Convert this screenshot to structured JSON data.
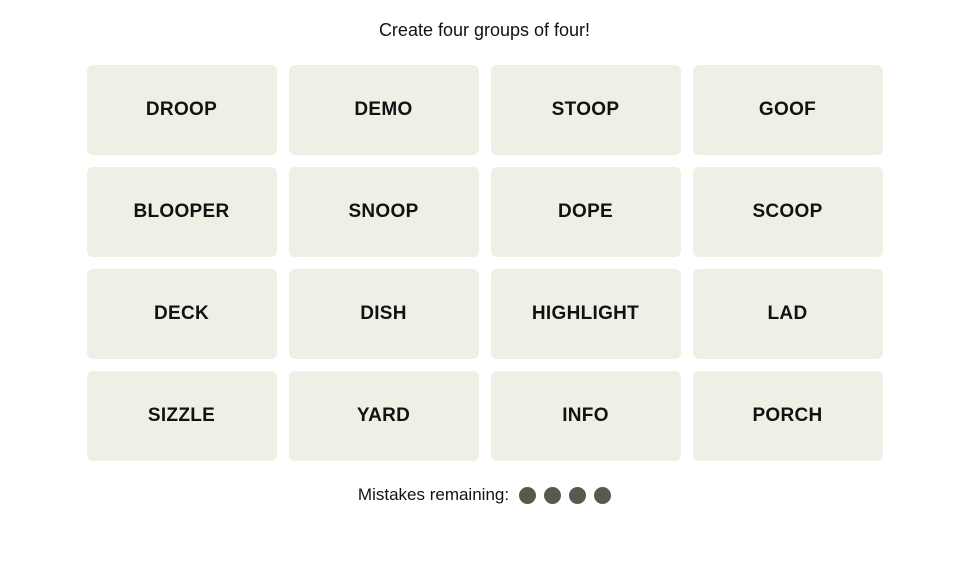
{
  "instruction": "Create four groups of four!",
  "tiles": [
    "DROOP",
    "DEMO",
    "STOOP",
    "GOOF",
    "BLOOPER",
    "SNOOP",
    "DOPE",
    "SCOOP",
    "DECK",
    "DISH",
    "HIGHLIGHT",
    "LAD",
    "SIZZLE",
    "YARD",
    "INFO",
    "PORCH"
  ],
  "mistakes": {
    "label": "Mistakes remaining:",
    "remaining": 4
  }
}
